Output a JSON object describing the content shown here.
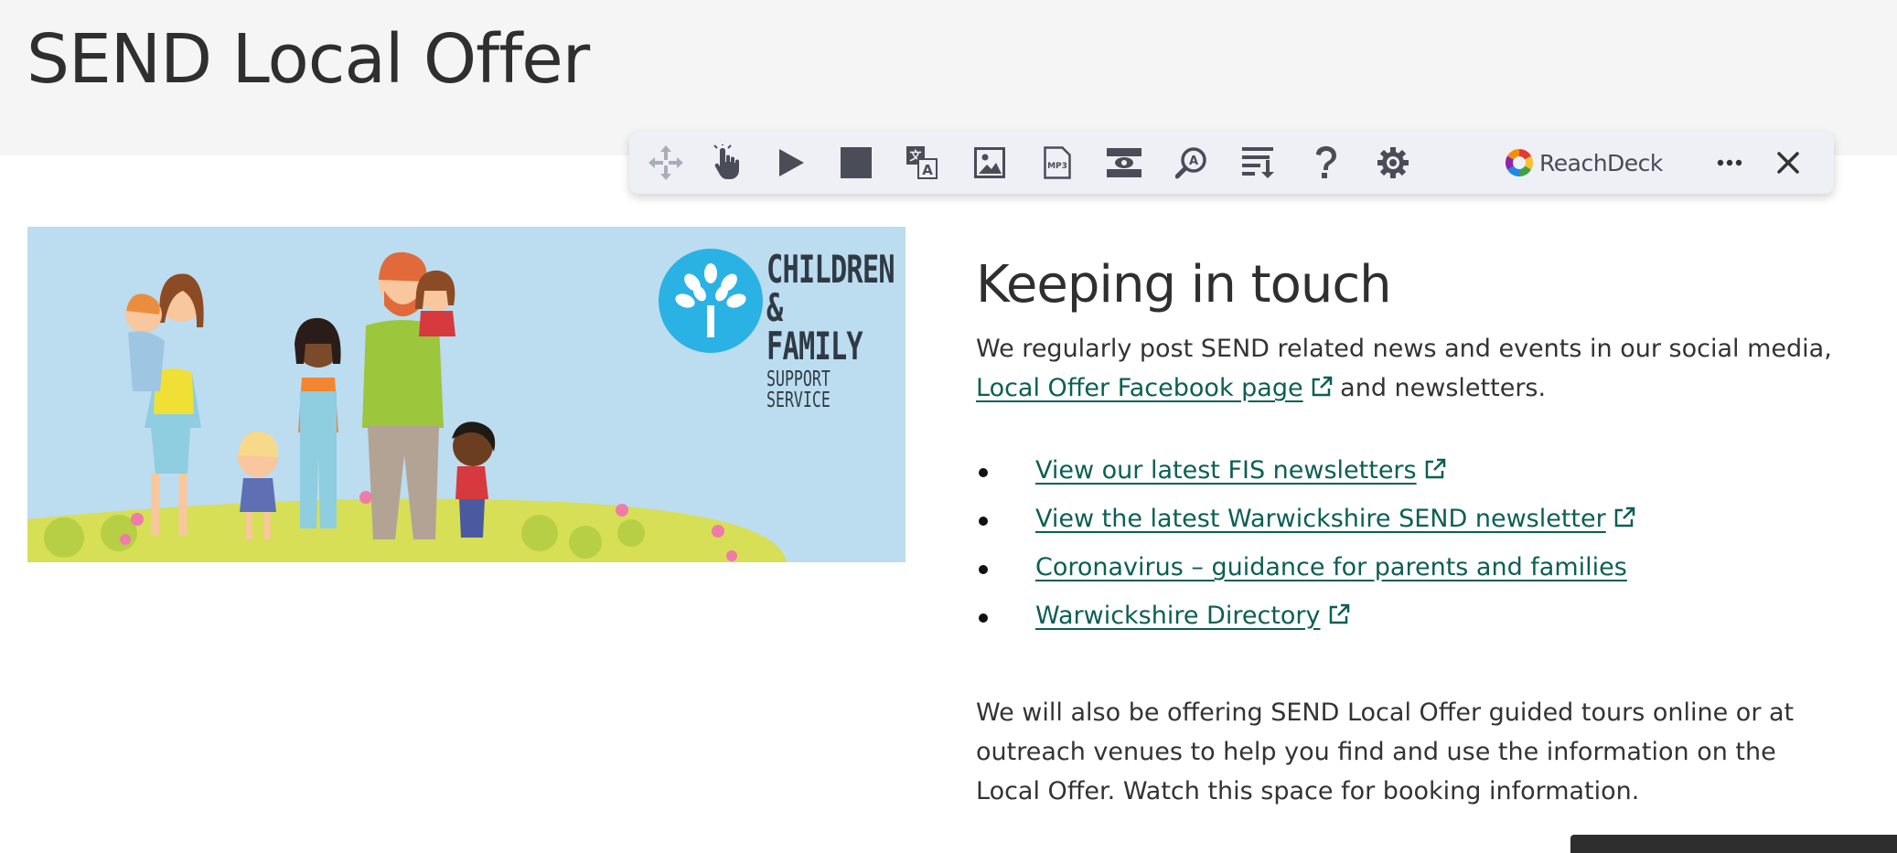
{
  "header": {
    "title": "SEND Local Offer"
  },
  "toolbar": {
    "buttons": [
      {
        "icon": "move-icon",
        "label": "Move"
      },
      {
        "icon": "pointer-hand-icon",
        "label": "Hover to speak"
      },
      {
        "icon": "play-icon",
        "label": "Play"
      },
      {
        "icon": "stop-icon",
        "label": "Stop"
      },
      {
        "icon": "translate-icon",
        "label": "Translate"
      },
      {
        "icon": "picture-dictionary-icon",
        "label": "Picture dictionary"
      },
      {
        "icon": "mp3-icon",
        "label": "MP3"
      },
      {
        "icon": "screen-mask-icon",
        "label": "Screen mask"
      },
      {
        "icon": "magnifier-icon",
        "label": "Magnifier"
      },
      {
        "icon": "simplifier-icon",
        "label": "Simplifier"
      },
      {
        "icon": "help-icon",
        "label": "Help"
      },
      {
        "icon": "settings-gear-icon",
        "label": "Settings"
      }
    ],
    "brand": "ReachDeck",
    "more_icon": "more-dots-icon",
    "close_icon": "close-icon",
    "mp3_text": "MP3"
  },
  "hero": {
    "logo_line1": "CHILDREN",
    "logo_line2": "& FAMILY",
    "logo_line3": "SUPPORT SERVICE"
  },
  "main": {
    "heading": "Keeping in touch",
    "intro_before": "We regularly post SEND related news and events in our social media, ",
    "intro_link": "Local Offer Facebook page",
    "intro_after": " and newsletters.",
    "links": [
      {
        "label": "View our latest FIS newsletters",
        "external": true
      },
      {
        "label": "View the latest Warwickshire SEND newsletter",
        "external": true
      },
      {
        "label": "Coronavirus – guidance for parents and families",
        "external": false
      },
      {
        "label": "Warwickshire Directory",
        "external": true
      }
    ],
    "tours_text": "We will also be offering SEND Local Offer guided tours online or at outreach venues to help you find and use the information on the Local Offer. Watch this space for booking information."
  },
  "colors": {
    "link": "#0b5f54",
    "title_band": "#f5f5f5",
    "toolbar_bg": "#eef0f6",
    "hero_bg": "#bcdcf0",
    "logo_blue": "#2ab2e4"
  }
}
